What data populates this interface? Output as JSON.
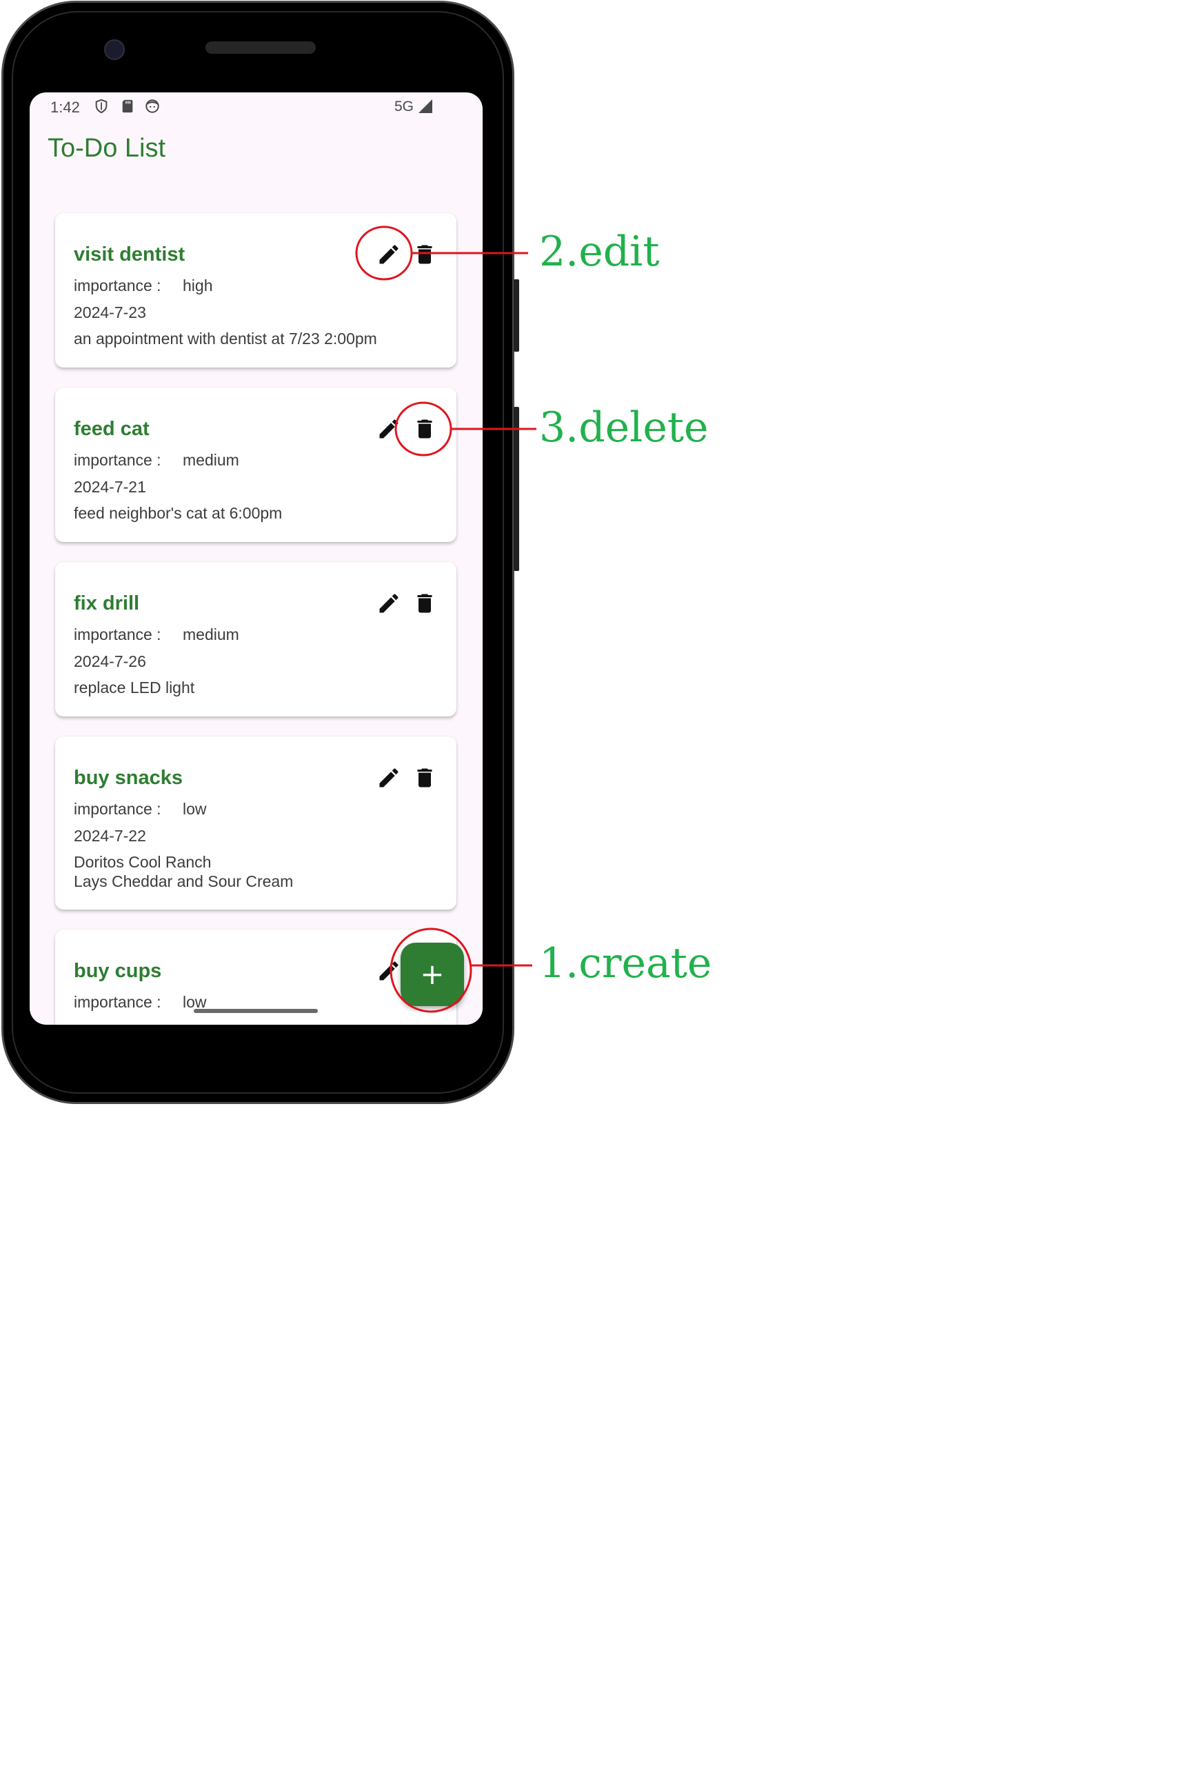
{
  "colors": {
    "accent": "#2e7d32",
    "background": "#fdf7fd",
    "annotation_circle": "#e0141e",
    "annotation_text": "#22b14c"
  },
  "status_bar": {
    "time": "1:42",
    "network": "5G",
    "icons": [
      "shield-icon",
      "sd-card-icon",
      "face-icon",
      "signal-icon"
    ]
  },
  "app": {
    "title": "To-Do List"
  },
  "todos": [
    {
      "title": "visit dentist",
      "importance_label": "importance :",
      "importance": "high",
      "date": "2024-7-23",
      "description": "an appointment with dentist at 7/23 2:00pm"
    },
    {
      "title": "feed cat",
      "importance_label": "importance :",
      "importance": "medium",
      "date": "2024-7-21",
      "description": "feed neighbor's cat at 6:00pm"
    },
    {
      "title": "fix drill",
      "importance_label": "importance :",
      "importance": "medium",
      "date": "2024-7-26",
      "description": "replace LED light"
    },
    {
      "title": "buy snacks",
      "importance_label": "importance :",
      "importance": "low",
      "date": "2024-7-22",
      "description": "Doritos Cool Ranch\nLays  Cheddar and Sour Cream"
    },
    {
      "title": "buy cups",
      "importance_label": "importance :",
      "importance": "low",
      "date": "",
      "description": ""
    }
  ],
  "fab": {
    "label": "+"
  },
  "annotations": {
    "create": "1.create",
    "edit": "2.edit",
    "delete": "3.delete"
  }
}
